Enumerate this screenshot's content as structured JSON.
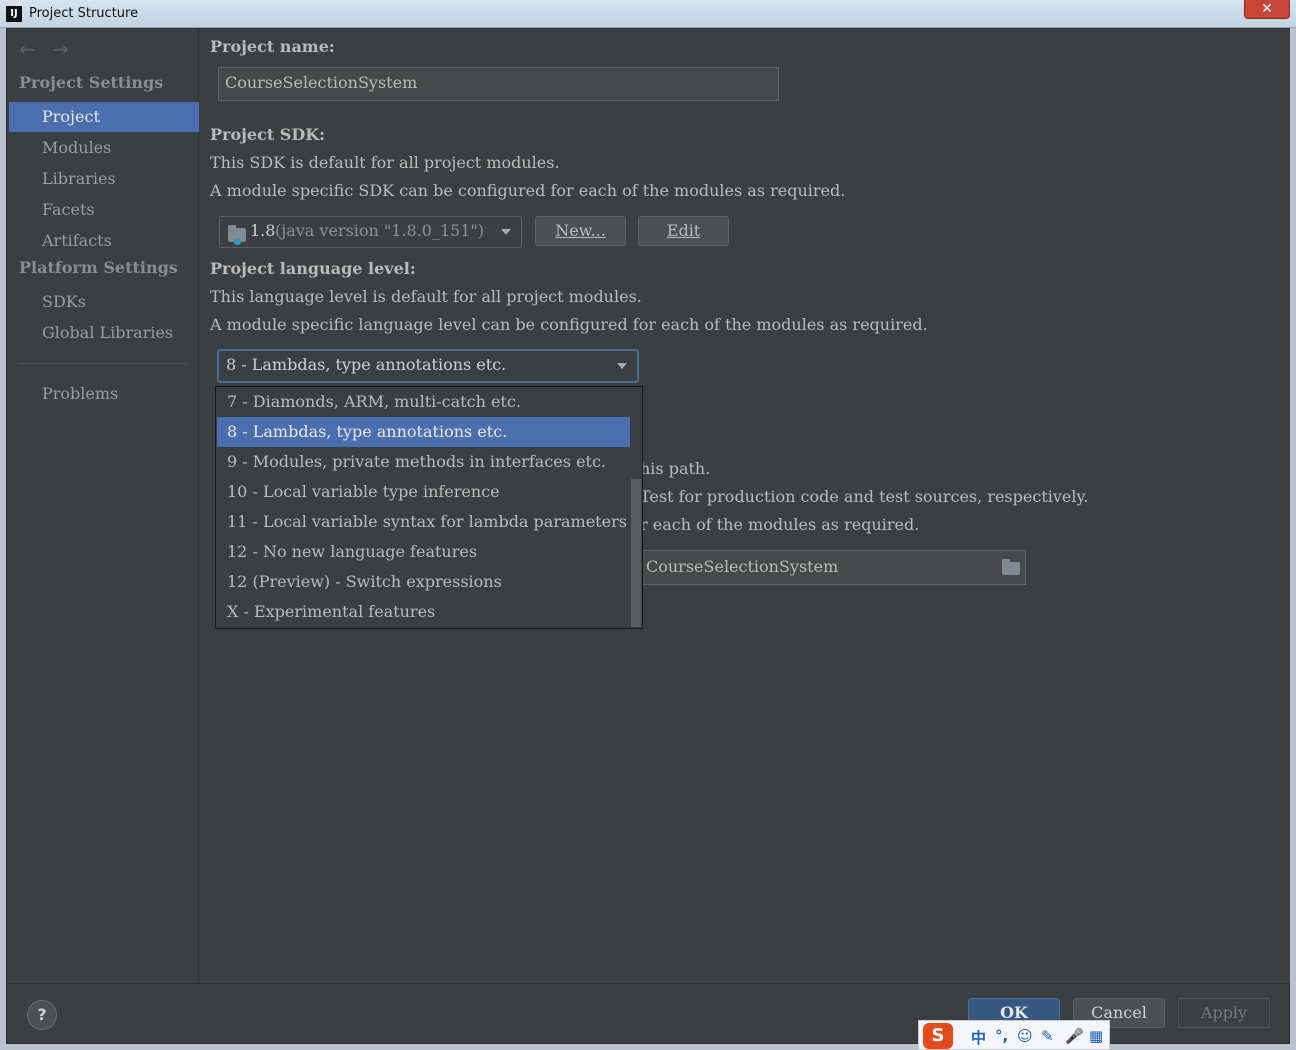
{
  "window": {
    "title": "Project Structure",
    "app_icon": "intellij-icon",
    "close_glyph": "✕"
  },
  "sidebar": {
    "nav_back": "←",
    "nav_forward": "→",
    "project_settings_header": "Project Settings",
    "project_items": [
      {
        "label": "Project",
        "selected": true
      },
      {
        "label": "Modules"
      },
      {
        "label": "Libraries"
      },
      {
        "label": "Facets"
      },
      {
        "label": "Artifacts"
      }
    ],
    "platform_settings_header": "Platform Settings",
    "platform_items": [
      {
        "label": "SDKs"
      },
      {
        "label": "Global Libraries"
      }
    ],
    "problems_label": "Problems"
  },
  "main": {
    "project_name_label": "Project name:",
    "project_name_value": "CourseSelectionSystem",
    "sdk_label": "Project SDK:",
    "sdk_desc1": "This SDK is default for all project modules.",
    "sdk_desc2": "A module specific SDK can be configured for each of the modules as required.",
    "sdk_selected_version": "1.8",
    "sdk_selected_detail": "(java version \"1.8.0_151\")",
    "sdk_new_button": "New...",
    "sdk_edit_button": "Edit",
    "lang_label": "Project language level:",
    "lang_desc1": "This language level is default for all project modules.",
    "lang_desc2": "A module specific language level can be configured for each of the modules as required.",
    "lang_selected": "8 - Lambdas, type annotations etc.",
    "lang_options": [
      "7 - Diamonds, ARM, multi-catch etc.",
      "8 - Lambdas, type annotations etc.",
      "9 - Modules, private methods in interfaces etc.",
      "10 - Local variable type inference",
      "11 - Local variable syntax for lambda parameters",
      "12 - No new language features",
      "12 (Preview) - Switch expressions",
      "X - Experimental features"
    ],
    "lang_selected_index": 1,
    "hidden_line1_tail": "his path.",
    "hidden_line2_tail": "Test for production code and test sources, respectively.",
    "hidden_line3_tail": "r each of the modules as required.",
    "output_path_visible": "CourseSelectionSystem"
  },
  "bottom": {
    "help_label": "?",
    "ok_label": "OK",
    "cancel_label": "Cancel",
    "apply_label": "Apply"
  },
  "ime": {
    "logo": "S",
    "items": [
      "中",
      "°,",
      "☺",
      "✎",
      "🎤",
      "▦"
    ]
  },
  "colors": {
    "selection": "#4b6eaf",
    "background": "#3c3f41",
    "text": "#bbbbbb"
  }
}
